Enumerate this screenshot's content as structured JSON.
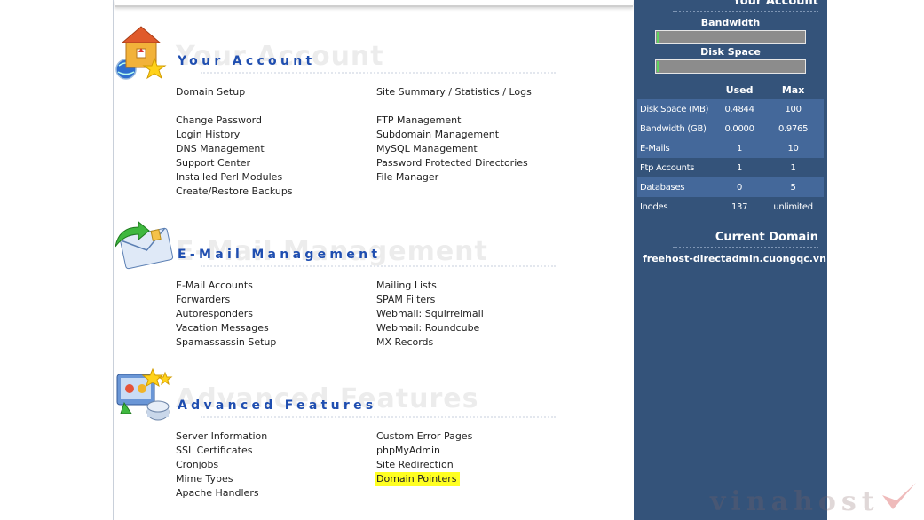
{
  "sections": {
    "your_account": {
      "title": "Your Account",
      "ghost": "Your Account",
      "col1": [
        "Domain Setup",
        "Change Password",
        "Login History",
        "DNS Management",
        "Support Center",
        "Installed Perl Modules",
        "Create/Restore Backups"
      ],
      "col2": [
        "Site Summary / Statistics / Logs",
        "FTP Management",
        "Subdomain Management",
        "MySQL Management",
        "Password Protected Directories",
        "File Manager"
      ]
    },
    "email": {
      "title": "E-Mail Management",
      "ghost": "E-Mail Management",
      "col1": [
        "E-Mail Accounts",
        "Forwarders",
        "Autoresponders",
        "Vacation Messages",
        "Spamassassin Setup"
      ],
      "col2": [
        "Mailing Lists",
        "SPAM Filters",
        "Webmail: Squirrelmail",
        "Webmail: Roundcube",
        "MX Records"
      ]
    },
    "advanced": {
      "title": "Advanced Features",
      "ghost": "Advanced Features",
      "col1": [
        "Server Information",
        "SSL Certificates",
        "Cronjobs",
        "Mime Types",
        "Apache Handlers"
      ],
      "col2": [
        "Custom Error Pages",
        "phpMyAdmin",
        "Site Redirection",
        "Domain Pointers"
      ]
    }
  },
  "highlighted_item": "Domain Pointers",
  "highlight_color": "#ffff22",
  "sidebar": {
    "account_title": "Your Account",
    "bandwidth_label": "Bandwidth",
    "disk_label": "Disk Space",
    "bandwidth_usage_fraction": 0.0,
    "disk_usage_fraction": 0.005,
    "stats_headers": {
      "used": "Used",
      "max": "Max"
    },
    "stats": [
      {
        "label": "Disk Space (MB)",
        "used": "0.4844",
        "max": "100"
      },
      {
        "label": "Bandwidth (GB)",
        "used": "0.0000",
        "max": "0.9765"
      },
      {
        "label": "E-Mails",
        "used": "1",
        "max": "10"
      },
      {
        "label": "Ftp Accounts",
        "used": "1",
        "max": "1"
      },
      {
        "label": "Databases",
        "used": "0",
        "max": "5"
      },
      {
        "label": "Inodes",
        "used": "137",
        "max": "unlimited"
      }
    ],
    "current_domain_title": "Current Domain",
    "current_domain": "freehost-directadmin.cuongqc.vn"
  },
  "watermark": "vinahost",
  "colors": {
    "sidebar_bg": "#34537a",
    "sidebar_alt_row": "#44689a",
    "section_title": "#1f4eb0"
  }
}
